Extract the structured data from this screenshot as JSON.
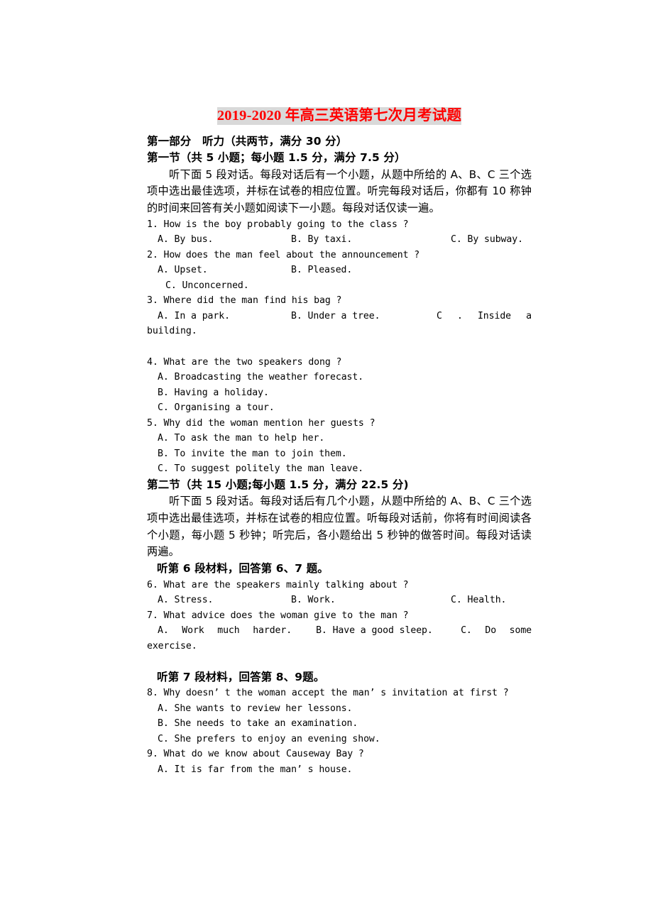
{
  "document": {
    "title": "2019-2020 年高三英语第七次月考试题",
    "title_color": "#FF0000",
    "title_highlight": "#D9D9D9",
    "part1_heading": "第一部分　听力（共两节，满分 30 分）",
    "section1_heading": "第一节（共 5 小题；每小题 1.5 分，满分 7.5 分）",
    "section1_instruction": "听下面 5 段对话。每段对话后有一个小题，从题中所给的 A、B、C 三个选项中选出最佳选项，并标在试卷的相应位置。听完每段对话后，你都有 10 称钟的时间来回答有关小题如阅读下一小题。每段对话仅读一遍。",
    "section2_heading": "第二节（共 15 小题;每小题 1.5 分，满分 22.5 分)",
    "section2_instruction": "听下面 5 段对话。每段对话后有几个小题，从题中所给的 A、B、C 三个选项中选出最佳选项，并标在试卷的相应位置。听每段对话前，你将有时间阅读各个小题，每小题 5 秒钟；听完后，各小题给出 5 秒钟的做答时间。每段对话读两遍。",
    "material6_heading": "听第 6 段材料，回答第 6、7 题。",
    "material7_heading": "听第 7 段材料，回答第 8、9题。"
  },
  "questions": {
    "q1": {
      "stem": "1. How is the boy probably going to the class ?",
      "a": "A. By bus.",
      "b": "B. By taxi.",
      "c": "C. By subway."
    },
    "q2": {
      "stem": "2. How does the man feel about the announcement ?",
      "a": "A. Upset.",
      "b": "B. Pleased.",
      "c": "C. Unconcerned."
    },
    "q3": {
      "stem": "3. Where did the man find his bag ?",
      "a": "A. In a park.",
      "b": "B. Under a tree.",
      "c": "C . Inside a building."
    },
    "q4": {
      "stem": "4. What are the two speakers dong ?",
      "a": "A. Broadcasting the weather forecast.",
      "b": "B. Having a holiday.",
      "c": "C. Organising a tour."
    },
    "q5": {
      "stem": "5. Why did the woman mention her guests ?",
      "a": "A. To ask the man to help her.",
      "b": "B. To invite the man to join them.",
      "c": "C. To suggest politely the man leave."
    },
    "q6": {
      "stem": "6. What are the speakers mainly talking about ?",
      "a": "A. Stress.",
      "b": "B. Work.",
      "c": "C. Health."
    },
    "q7": {
      "stem": "7. What advice does the woman give to the man ?",
      "a": "A. Work much harder.",
      "b": "B. Have a good sleep.",
      "c": "C. Do some exercise."
    },
    "q8": {
      "stem": "8. Why doesn’ t the woman accept the man’ s invitation at first ?",
      "a": "A. She wants to review her lessons.",
      "b": "B. She needs to take an examination.",
      "c": "C. She prefers to enjoy an evening show."
    },
    "q9": {
      "stem": "9. What do we know about Causeway Bay ?",
      "a": "A. It is far from the man’ s house."
    }
  }
}
